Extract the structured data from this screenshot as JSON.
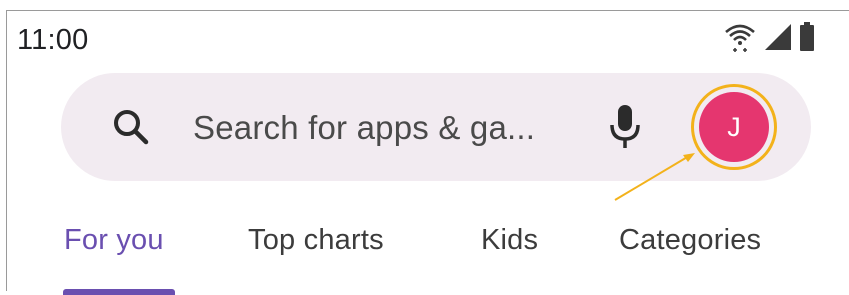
{
  "status_bar": {
    "time": "11:00",
    "icons": [
      "wifi-icon",
      "signal-icon",
      "battery-icon"
    ]
  },
  "search": {
    "placeholder": "Search for apps & ga...",
    "search_icon": "search-icon",
    "mic_icon": "mic-icon"
  },
  "account": {
    "avatar_initial": "J",
    "avatar_color": "#e5366f",
    "highlight_color": "#f3b21b"
  },
  "tabs": [
    {
      "label": "For you",
      "active": true
    },
    {
      "label": "Top charts",
      "active": false
    },
    {
      "label": "Kids",
      "active": false
    },
    {
      "label": "Categories",
      "active": false
    }
  ],
  "colors": {
    "accent": "#6a4fb0",
    "search_bg": "#f2ebf1",
    "text": "#202124"
  }
}
